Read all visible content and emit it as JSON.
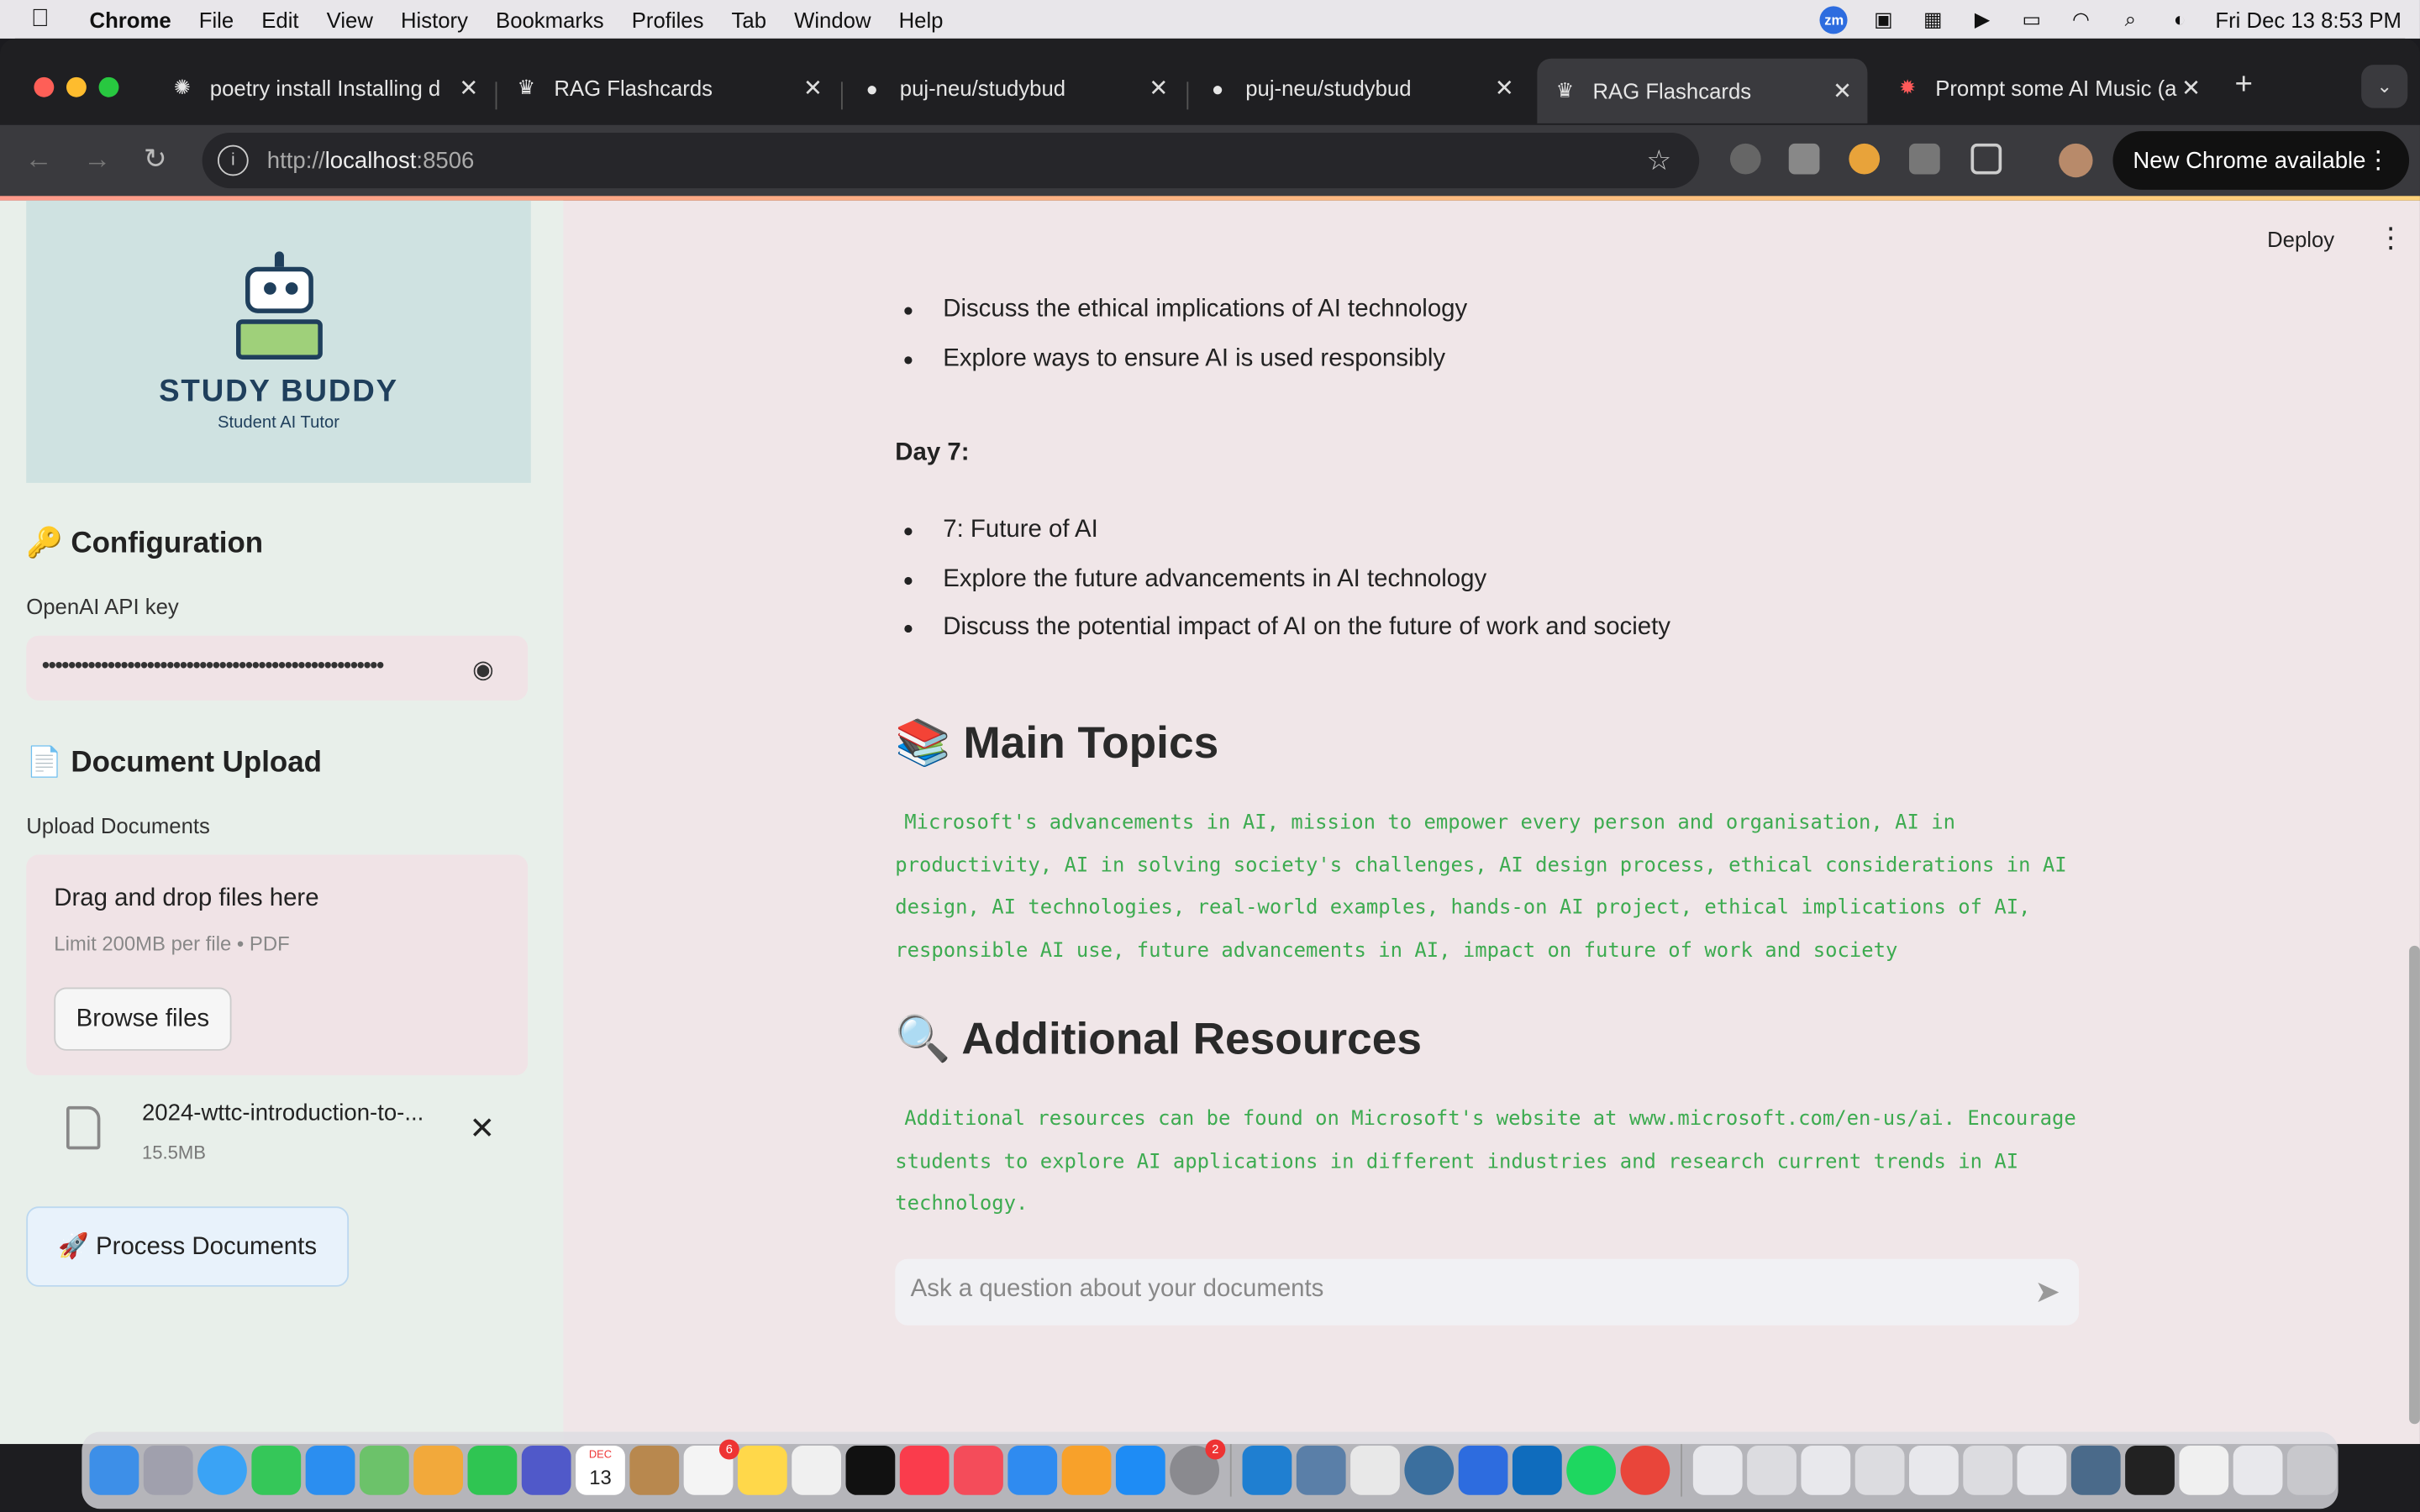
{
  "menubar": {
    "app": "Chrome",
    "items": [
      "File",
      "Edit",
      "View",
      "History",
      "Bookmarks",
      "Profiles",
      "Tab",
      "Window",
      "Help"
    ],
    "clock": "Fri Dec 13  8:53 PM",
    "zoom_badge": "zm"
  },
  "tabs": [
    {
      "title": "poetry install Installing d"
    },
    {
      "title": "RAG Flashcards"
    },
    {
      "title": "puj-neu/studybud"
    },
    {
      "title": "puj-neu/studybud"
    },
    {
      "title": "RAG Flashcards"
    },
    {
      "title": "Prompt some AI Music (a"
    }
  ],
  "toolbar": {
    "url_prefix": "http://",
    "url_host": "localhost",
    "url_port": ":8506",
    "new_chrome": "New Chrome available"
  },
  "sidebar": {
    "logo_name": "STUDY BUDDY",
    "logo_sub": "Student AI Tutor",
    "config_title": "🔑 Configuration",
    "api_label": "OpenAI API key",
    "api_value": "••••••••••••••••••••••••••••••••••••••••••••••••••••",
    "upload_title": "📄 Document Upload",
    "upload_label": "Upload Documents",
    "drop_title": "Drag and drop files here",
    "drop_limit": "Limit 200MB per file • PDF",
    "browse": "Browse files",
    "file_name": "2024-wttc-introduction-to-...",
    "file_size": "15.5MB",
    "process": "🚀 Process Documents"
  },
  "main": {
    "deploy": "Deploy",
    "bullets_top": [
      "Discuss the ethical implications of AI technology",
      "Explore ways to ensure AI is used responsibly"
    ],
    "day7": "Day 7:",
    "bullets_day7": [
      "7: Future of AI",
      "Explore the future advancements in AI technology",
      "Discuss the potential impact of AI on the future of work and society"
    ],
    "main_topics_title": "📚 Main Topics",
    "main_topics_text": "Microsoft's advancements in AI, mission to empower every person and organisation, AI in productivity, AI in solving society's challenges, AI design process, ethical considerations in AI design, AI technologies, real-world examples, hands-on AI project, ethical implications of AI, responsible AI use, future advancements in AI, impact on future of work and society",
    "resources_title": "🔍 Additional Resources",
    "resources_text": "Additional resources can be found on Microsoft's website at www.microsoft.com/en-us/ai. Encourage students to explore AI applications in different industries and research current trends in AI technology.",
    "chat_placeholder": "Ask a question about your documents"
  },
  "dock": {
    "calendar_month": "DEC",
    "calendar_day": "13",
    "reminders_badge": "6",
    "settings_badge": "2"
  }
}
